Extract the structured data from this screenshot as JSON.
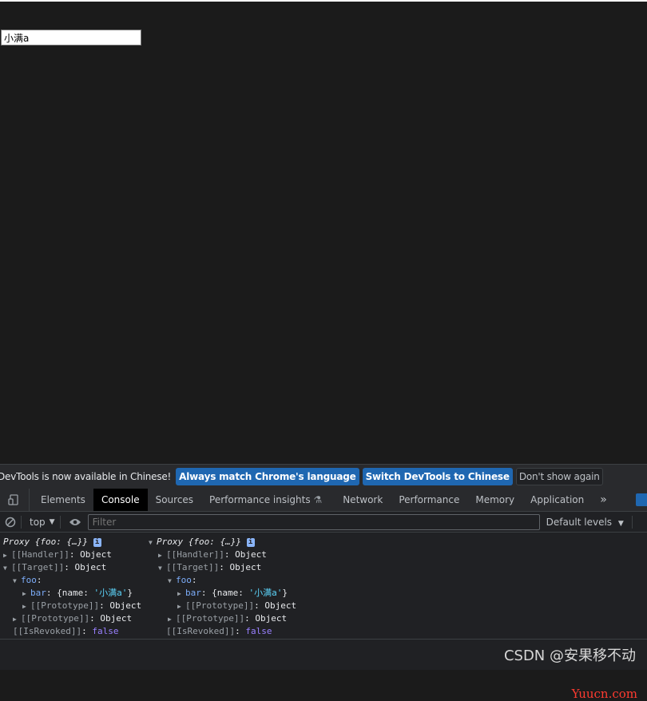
{
  "page": {
    "input_value": "小满a"
  },
  "banner": {
    "text": "DevTools is now available in Chinese!",
    "btn_match": "Always match Chrome's language",
    "btn_switch": "Switch DevTools to Chinese",
    "btn_dismiss": "Don't show again"
  },
  "tabs": [
    "Elements",
    "Console",
    "Sources",
    "Performance insights",
    "Network",
    "Performance",
    "Memory",
    "Application"
  ],
  "toolbar": {
    "context": "top",
    "filter_placeholder": "Filter",
    "levels": "Default levels"
  },
  "console": {
    "proxy_label": "Proxy",
    "proxy_preview": "{foo: {…}}",
    "handler": "[[Handler]]",
    "target": "[[Target]]",
    "object": "Object",
    "foo_key": "foo",
    "bar_key": "bar",
    "bar_preview_pre": "{name: ",
    "bar_preview_val": "'小满a'",
    "bar_preview_post": "}",
    "prototype": "[[Prototype]]",
    "revoked": "[[IsRevoked]]",
    "revoked_val": "false",
    "info": "i"
  },
  "watermark": {
    "site": "Yuucn.com",
    "author": "CSDN @安果移不动"
  },
  "colors": {
    "accent": "#8ab4f8",
    "string": "#5cd5fb",
    "boolean": "#9980ff",
    "banner_button": "#1f67b1"
  }
}
